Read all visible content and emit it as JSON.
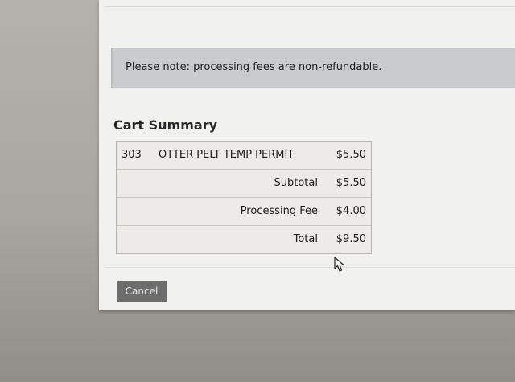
{
  "notice": {
    "text": "Please note: processing fees are non-refundable."
  },
  "cart": {
    "title": "Cart Summary",
    "item": {
      "quantity": "303",
      "description": "OTTER PELT TEMP PERMIT",
      "price": "$5.50"
    },
    "totals": [
      {
        "label": "Subtotal",
        "amount": "$5.50"
      },
      {
        "label": "Processing Fee",
        "amount": "$4.00"
      },
      {
        "label": "Total",
        "amount": "$9.50"
      }
    ]
  },
  "actions": {
    "cancel_label": "Cancel"
  },
  "icons": {
    "cursor": "mouse-pointer-icon"
  }
}
